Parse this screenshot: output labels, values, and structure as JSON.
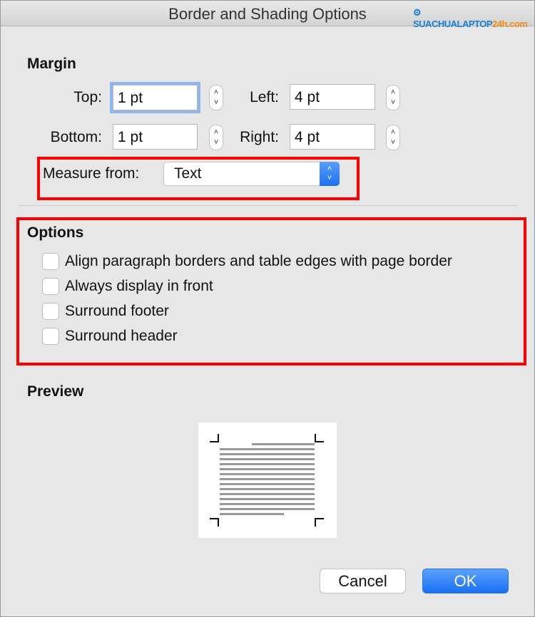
{
  "window": {
    "title": "Border and Shading Options",
    "watermark": "SUACHUALAPTOP24h.com"
  },
  "margin": {
    "heading": "Margin",
    "top": {
      "label": "Top:",
      "value": "1 pt"
    },
    "left": {
      "label": "Left:",
      "value": "4 pt"
    },
    "bottom": {
      "label": "Bottom:",
      "value": "1 pt"
    },
    "right": {
      "label": "Right:",
      "value": "4 pt"
    },
    "measure_from": {
      "label": "Measure from:",
      "value": "Text"
    }
  },
  "options": {
    "heading": "Options",
    "items": [
      {
        "label": "Align paragraph borders and table edges with page border",
        "checked": false
      },
      {
        "label": "Always display in front",
        "checked": false
      },
      {
        "label": "Surround footer",
        "checked": false
      },
      {
        "label": "Surround header",
        "checked": false
      }
    ]
  },
  "preview": {
    "heading": "Preview"
  },
  "buttons": {
    "cancel": "Cancel",
    "ok": "OK"
  },
  "colors": {
    "accent": "#1c6ff0",
    "highlight": "#ff0000"
  }
}
